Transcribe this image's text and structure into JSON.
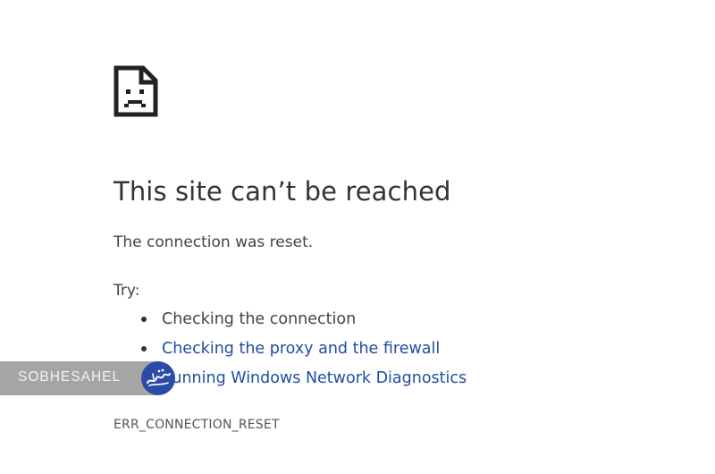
{
  "error_page": {
    "title": "This site can’t be reached",
    "subtitle": "The connection was reset.",
    "try_label": "Try:",
    "suggestions": [
      {
        "label": "Checking the connection",
        "is_link": false
      },
      {
        "label": "Checking the proxy and the firewall",
        "is_link": true
      },
      {
        "label": "Running Windows Network Diagnostics",
        "is_link": true
      }
    ],
    "error_code": "ERR_CONNECTION_RESET",
    "icon": "sad-page-icon"
  },
  "watermark": {
    "text": "SOBHESAHEL",
    "logo": "sobhesahel-logo-icon"
  },
  "colors": {
    "link": "#1f4ea1",
    "title": "#333333",
    "body_text": "#444444",
    "watermark_bar": "#828282",
    "watermark_logo": "#2c4aa8"
  }
}
